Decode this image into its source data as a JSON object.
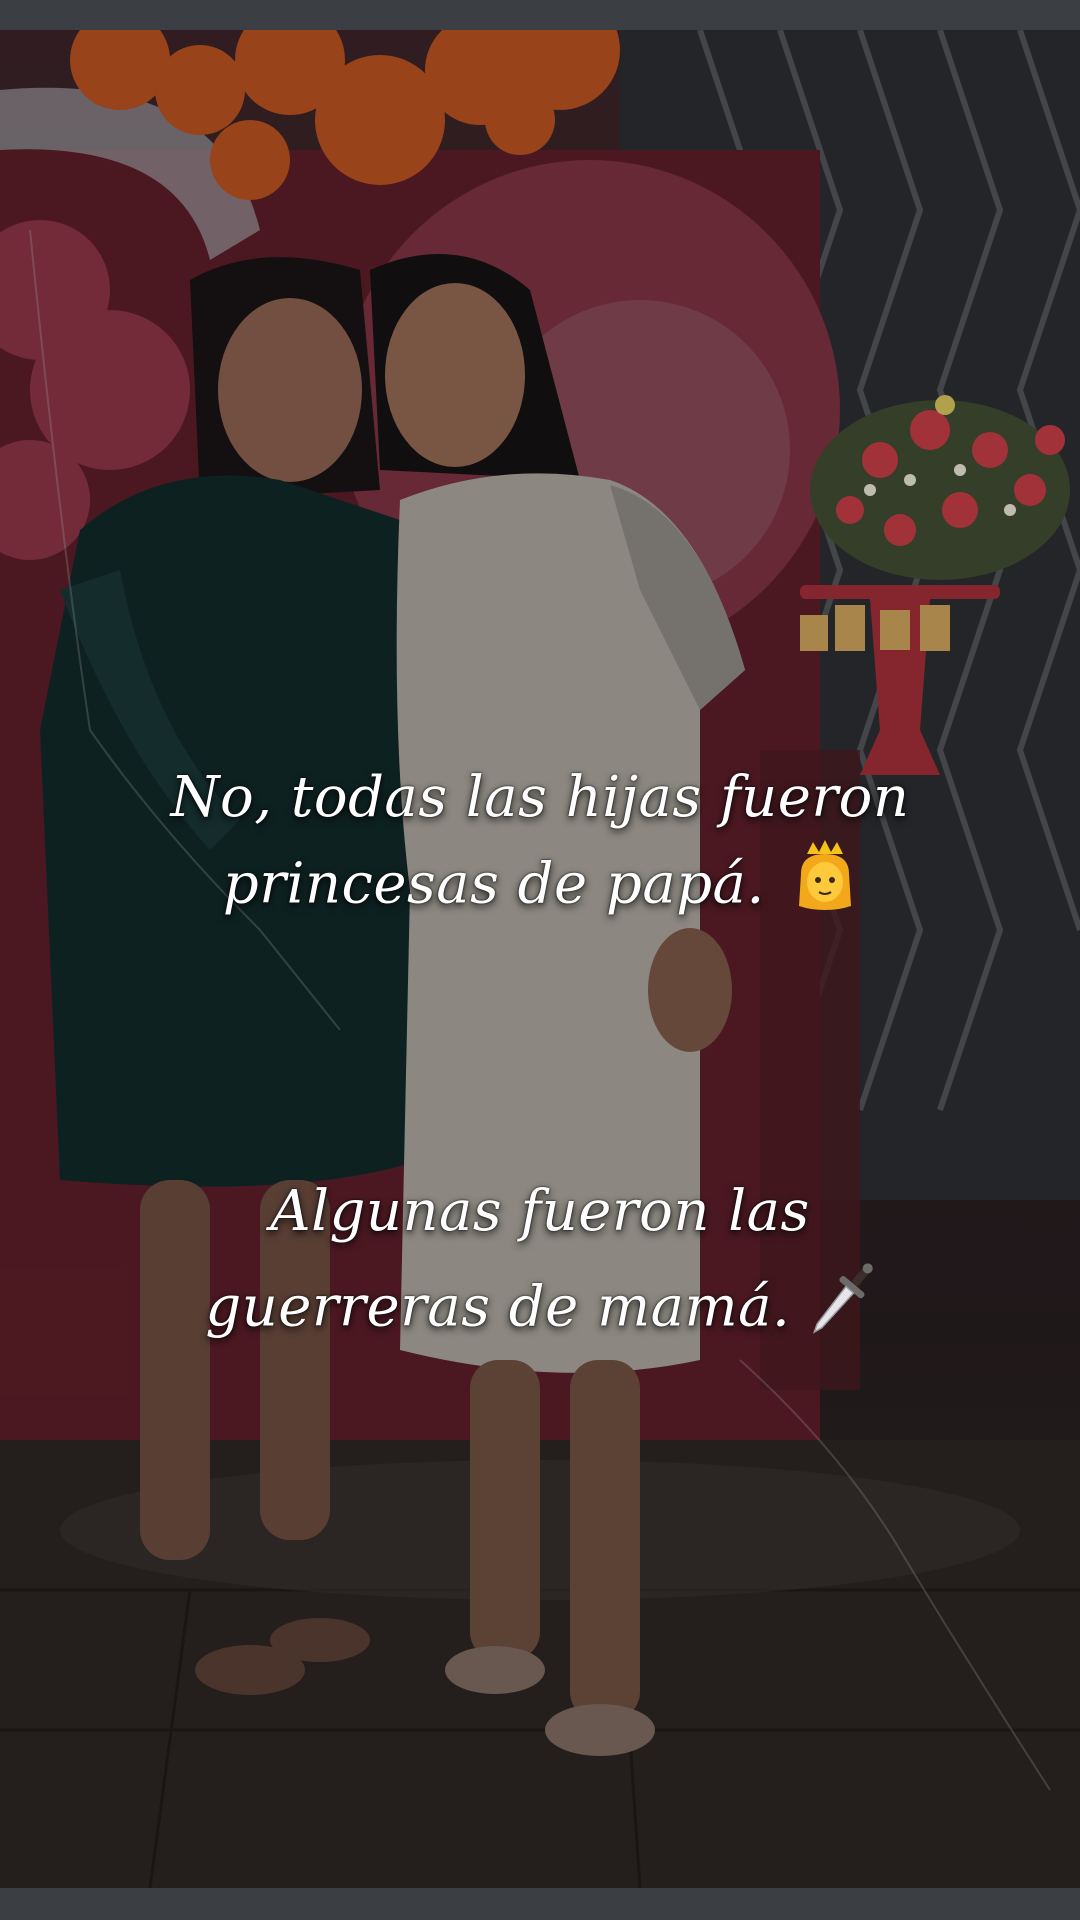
{
  "caption": {
    "line1": "No, todas las hijas fueron",
    "line2": "princesas de papá.",
    "line2_emoji": "princess-emoji",
    "line3": "Algunas fueron las",
    "line4": "guerreras de mamá.",
    "line4_emoji": "dagger-emoji"
  },
  "colors": {
    "frame": "#3b3f44",
    "text": "#ffffff",
    "balloons": "#d9631e",
    "backdrop_pink": "#c2455a",
    "dress_dark": "#0f2a2a",
    "dress_light": "#cfcac2"
  }
}
